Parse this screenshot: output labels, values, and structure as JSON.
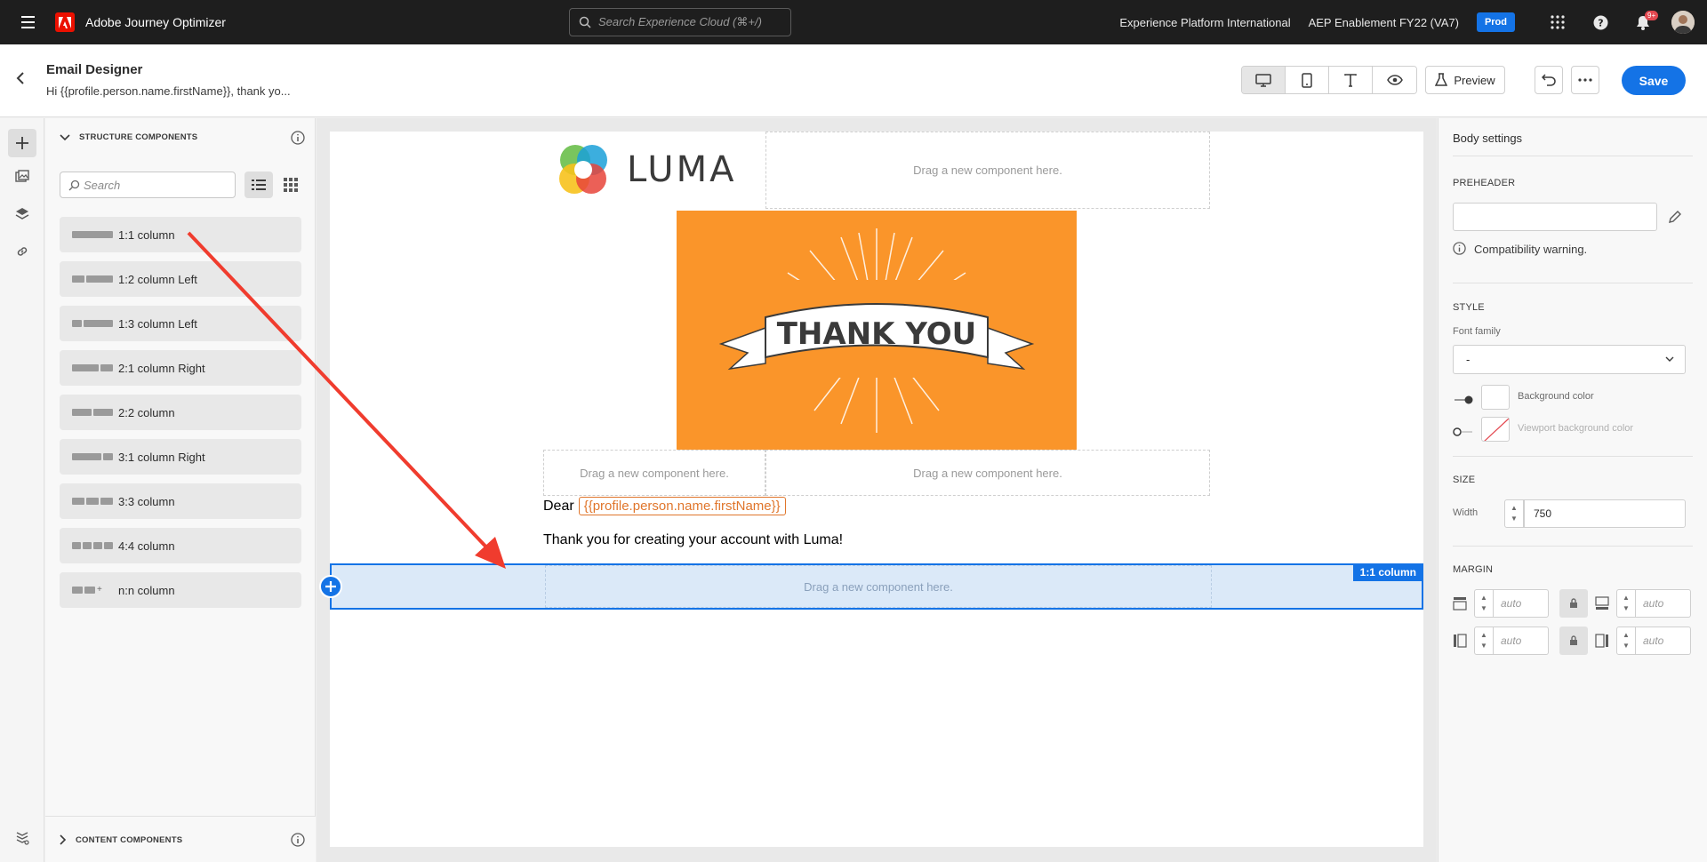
{
  "topbar": {
    "app_name": "Adobe Journey Optimizer",
    "search_placeholder": "Search Experience Cloud (⌘+/)",
    "org_name": "Experience Platform International",
    "sandbox_name": "AEP Enablement FY22 (VA7)",
    "env_badge": "Prod",
    "notification_count": "9+"
  },
  "header": {
    "title": "Email Designer",
    "subtitle": "Hi {{profile.person.name.firstName}}, thank yo...",
    "preview_label": "Preview",
    "save_label": "Save"
  },
  "panel": {
    "structure_title": "STRUCTURE COMPONENTS",
    "search_placeholder": "Search",
    "items": [
      {
        "label": "1:1 column"
      },
      {
        "label": "1:2 column Left"
      },
      {
        "label": "1:3 column Left"
      },
      {
        "label": "2:1 column Right"
      },
      {
        "label": "2:2 column"
      },
      {
        "label": "3:1 column Right"
      },
      {
        "label": "3:3 column"
      },
      {
        "label": "4:4 column"
      },
      {
        "label": "n:n column"
      }
    ],
    "content_title": "CONTENT COMPONENTS"
  },
  "canvas": {
    "logo_text": "LUMA",
    "drop_text": "Drag a new component here.",
    "hero_text": "THANK YOU",
    "dear_label": "Dear",
    "personalization_token": "{{profile.person.name.firstName}}",
    "body_line": "Thank you for creating your account with Luma!",
    "selected_row_tag": "1:1 column"
  },
  "settings": {
    "title": "Body settings",
    "preheader_label": "PREHEADER",
    "compat_warning": "Compatibility warning.",
    "style_label": "STYLE",
    "font_family_label": "Font family",
    "font_family_value": "-",
    "bg_color_label": "Background color",
    "viewport_bg_label": "Viewport background color",
    "size_label": "SIZE",
    "width_label": "Width",
    "width_value": "750",
    "margin_label": "MARGIN",
    "margin_placeholder": "auto"
  },
  "colors": {
    "accent": "#1473e6",
    "hero_orange": "#fa952a",
    "token_orange": "#e0762c",
    "annotation_red": "#f03c2e"
  }
}
